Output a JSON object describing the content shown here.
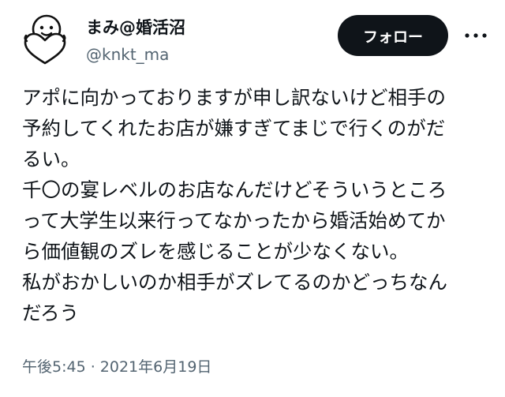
{
  "user": {
    "display_name": "まみ@婚活沼",
    "handle": "@knkt_ma",
    "avatar_icon": "smiley-heart-icon"
  },
  "actions": {
    "follow_label": "フォロー",
    "more_icon": "more-options-icon"
  },
  "tweet": {
    "lines": [
      "アポに向かっておりますが申し訳ないけど相手の",
      "予約してくれたお店が嫌すぎてまじで行くのがだ",
      "るい。",
      "千〇の宴レベルのお店なんだけどそういうところ",
      "って大学生以来行ってなかったから婚活始めてか",
      "ら価値観のズレを感じることが少なくない。",
      "私がおかしいのか相手がズレてるのかどっちなん",
      "だろう"
    ],
    "timestamp": "午後5:45 · 2021年6月19日"
  },
  "colors": {
    "text": "#0f1419",
    "secondary": "#536471",
    "follow_bg": "#0f1419",
    "follow_text": "#ffffff"
  }
}
